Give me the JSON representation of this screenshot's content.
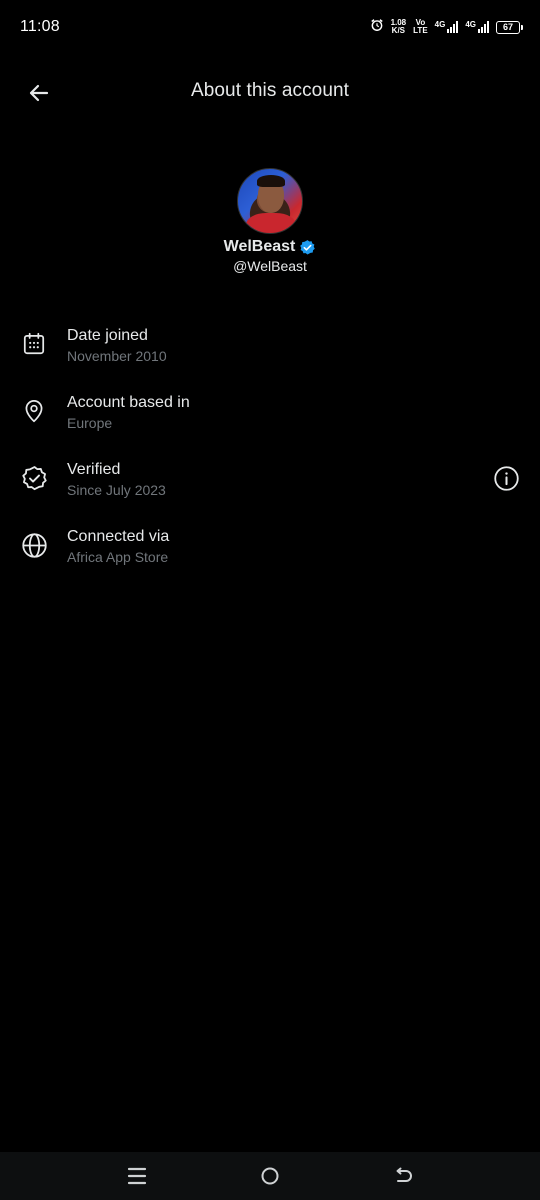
{
  "status_bar": {
    "time": "11:08",
    "speed_value": "1.08",
    "speed_unit": "K/S",
    "volte_top": "Vo",
    "volte_bottom": "LTE",
    "net1": "4G",
    "net2": "4G",
    "battery": "67"
  },
  "header": {
    "title": "About this account"
  },
  "profile": {
    "display_name": "WelBeast",
    "handle": "@WelBeast",
    "verified_color": "#1d9bf0"
  },
  "info": [
    {
      "icon": "calendar-icon",
      "title": "Date joined",
      "subtitle": "November 2010"
    },
    {
      "icon": "location-pin-icon",
      "title": "Account based in",
      "subtitle": "Europe"
    },
    {
      "icon": "verified-badge-icon",
      "title": "Verified",
      "subtitle": "Since July 2023"
    },
    {
      "icon": "globe-icon",
      "title": "Connected via",
      "subtitle": "Africa App Store"
    }
  ],
  "colors": {
    "background": "#000000",
    "primary_text": "#e7e9ea",
    "secondary_text": "#71767b",
    "accent": "#1d9bf0"
  }
}
